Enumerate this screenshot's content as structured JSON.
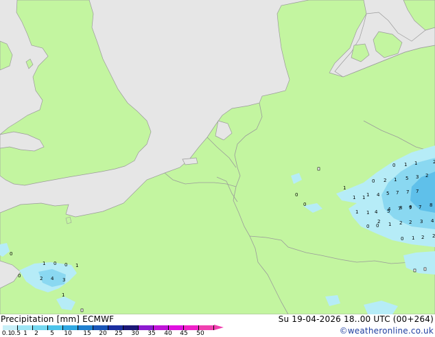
{
  "header": {
    "title_left": "Precipitation [mm]  ECMWF",
    "title_right": "Su 19-04-2026 18..00 UTC (00+264)",
    "credit": "©weatheronline.co.uk"
  },
  "colorbar": {
    "labels": [
      "0.1",
      "0.5",
      "1",
      "2",
      "5",
      "10",
      "15",
      "20",
      "25",
      "30",
      "35",
      "40",
      "45",
      "50"
    ],
    "colors": [
      "#c8f0f8",
      "#9ee6f5",
      "#74d8f0",
      "#4cc4ea",
      "#30a8e2",
      "#1f80d0",
      "#1a56b8",
      "#1b2fa0",
      "#1c1878",
      "#8c1ad0",
      "#c014d8",
      "#e010e0",
      "#f020c8",
      "#f040b0"
    ]
  },
  "map": {
    "colors": {
      "sea": "#e6e6e6",
      "land": "#c3f5a0",
      "border": "#9a9a9a",
      "precip_light": "#b6ecf7",
      "precip_mid": "#8ad8f1",
      "precip_heavy": "#5fc0ea"
    },
    "labels_east": [
      {
        "t": "0"
      },
      {
        "t": "1"
      },
      {
        "t": "1"
      },
      {
        "t": "2"
      },
      {
        "t": "0"
      },
      {
        "t": "2"
      },
      {
        "t": "1"
      },
      {
        "t": "5"
      },
      {
        "t": "3"
      },
      {
        "t": "2"
      },
      {
        "t": "1"
      },
      {
        "t": "4"
      },
      {
        "t": "5"
      },
      {
        "t": "7"
      },
      {
        "t": "7"
      },
      {
        "t": "7"
      },
      {
        "t": "1"
      },
      {
        "t": "1"
      },
      {
        "t": "1"
      },
      {
        "t": "4"
      },
      {
        "t": "5"
      },
      {
        "t": "7"
      },
      {
        "t": "7"
      },
      {
        "t": "7"
      },
      {
        "t": "1"
      },
      {
        "t": "1"
      },
      {
        "t": "2"
      },
      {
        "t": "4"
      },
      {
        "t": "8"
      },
      {
        "t": "6"
      },
      {
        "t": "8"
      },
      {
        "t": "0"
      },
      {
        "t": "0"
      },
      {
        "t": "1"
      },
      {
        "t": "2"
      },
      {
        "t": "2"
      },
      {
        "t": "3"
      },
      {
        "t": "4"
      },
      {
        "t": "0"
      },
      {
        "t": "1"
      },
      {
        "t": "2"
      },
      {
        "t": "2"
      },
      {
        "t": "0"
      },
      {
        "t": "0"
      }
    ],
    "labels_west": [
      {
        "t": "1"
      },
      {
        "t": "0"
      },
      {
        "t": "0"
      },
      {
        "t": "1"
      },
      {
        "t": "0"
      },
      {
        "t": "2"
      },
      {
        "t": "4"
      },
      {
        "t": "3"
      },
      {
        "t": "1"
      },
      {
        "t": "0"
      }
    ]
  }
}
